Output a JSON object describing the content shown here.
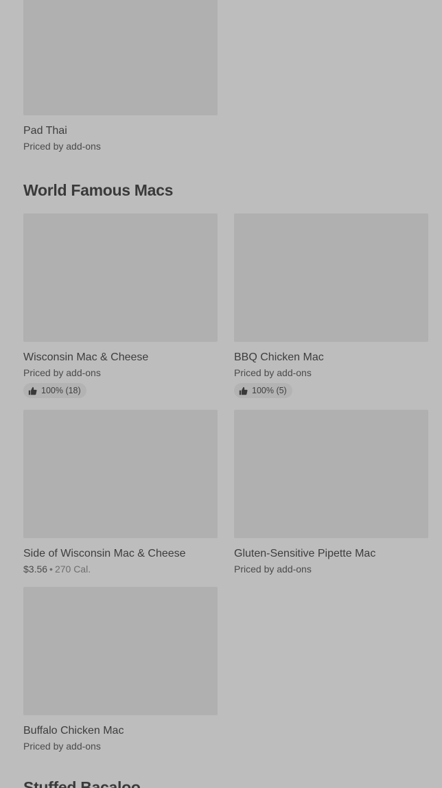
{
  "top_item": {
    "name": "Pad Thai",
    "price": "Priced by add-ons"
  },
  "sections": [
    {
      "title": "World Famous Macs",
      "items": [
        {
          "name": "Wisconsin Mac & Cheese",
          "price": "Priced by add-ons",
          "rating": "100% (18)"
        },
        {
          "name": "BBQ Chicken Mac",
          "price": "Priced by add-ons",
          "rating": "100% (5)"
        },
        {
          "name": "Side of Wisconsin Mac & Cheese",
          "price": "$3.56",
          "separator": "•",
          "calories": "270 Cal."
        },
        {
          "name": "Gluten-Sensitive Pipette Mac",
          "price": "Priced by add-ons"
        },
        {
          "name": "Buffalo Chicken Mac",
          "price": "Priced by add-ons"
        }
      ]
    },
    {
      "title": "Stuffed Bacaloo"
    }
  ],
  "icons": {
    "rating": "thumbs-up-icon"
  },
  "colors": {
    "background": "#bdbdbd",
    "image_placeholder": "#b0b0b0",
    "rating_pill": "#b3b3b3"
  }
}
